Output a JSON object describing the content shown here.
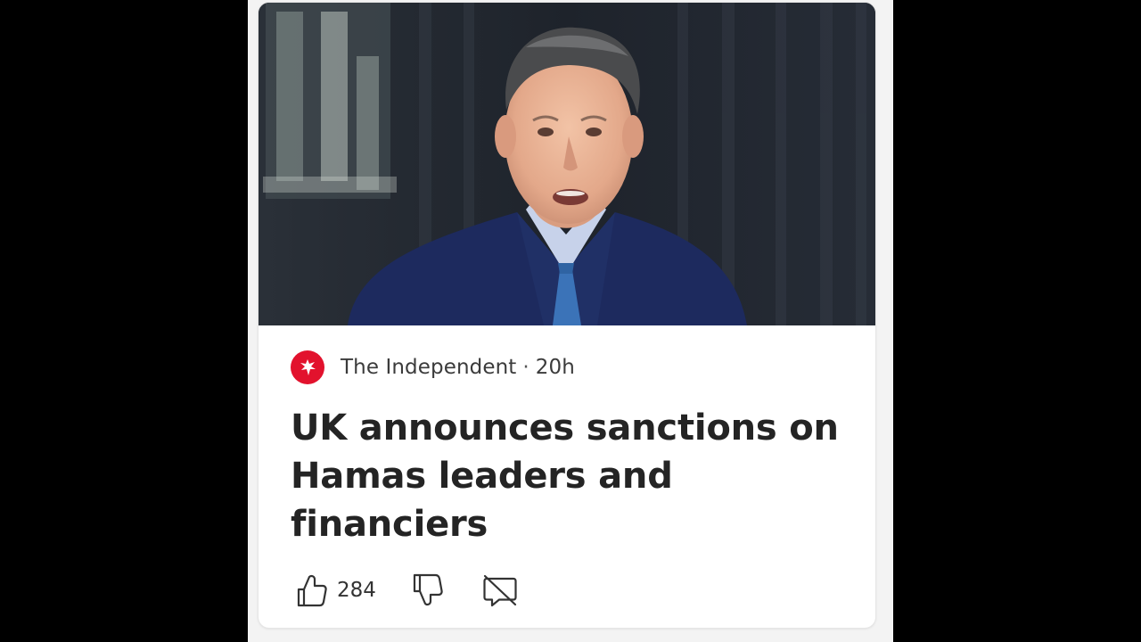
{
  "article": {
    "image_alt": "Man in a navy suit and blue tie speaking outside a dark building",
    "source": {
      "name": "The Independent",
      "separator": "·",
      "age": "20h",
      "logo_icon": "independent-eagle-icon",
      "logo_color": "#e2122d"
    },
    "headline": "UK announces sanctions on Hamas leaders and financiers"
  },
  "actions": {
    "like_icon": "thumbs-up-icon",
    "like_count": "284",
    "dislike_icon": "thumbs-down-icon",
    "comments_icon": "comments-off-icon"
  }
}
